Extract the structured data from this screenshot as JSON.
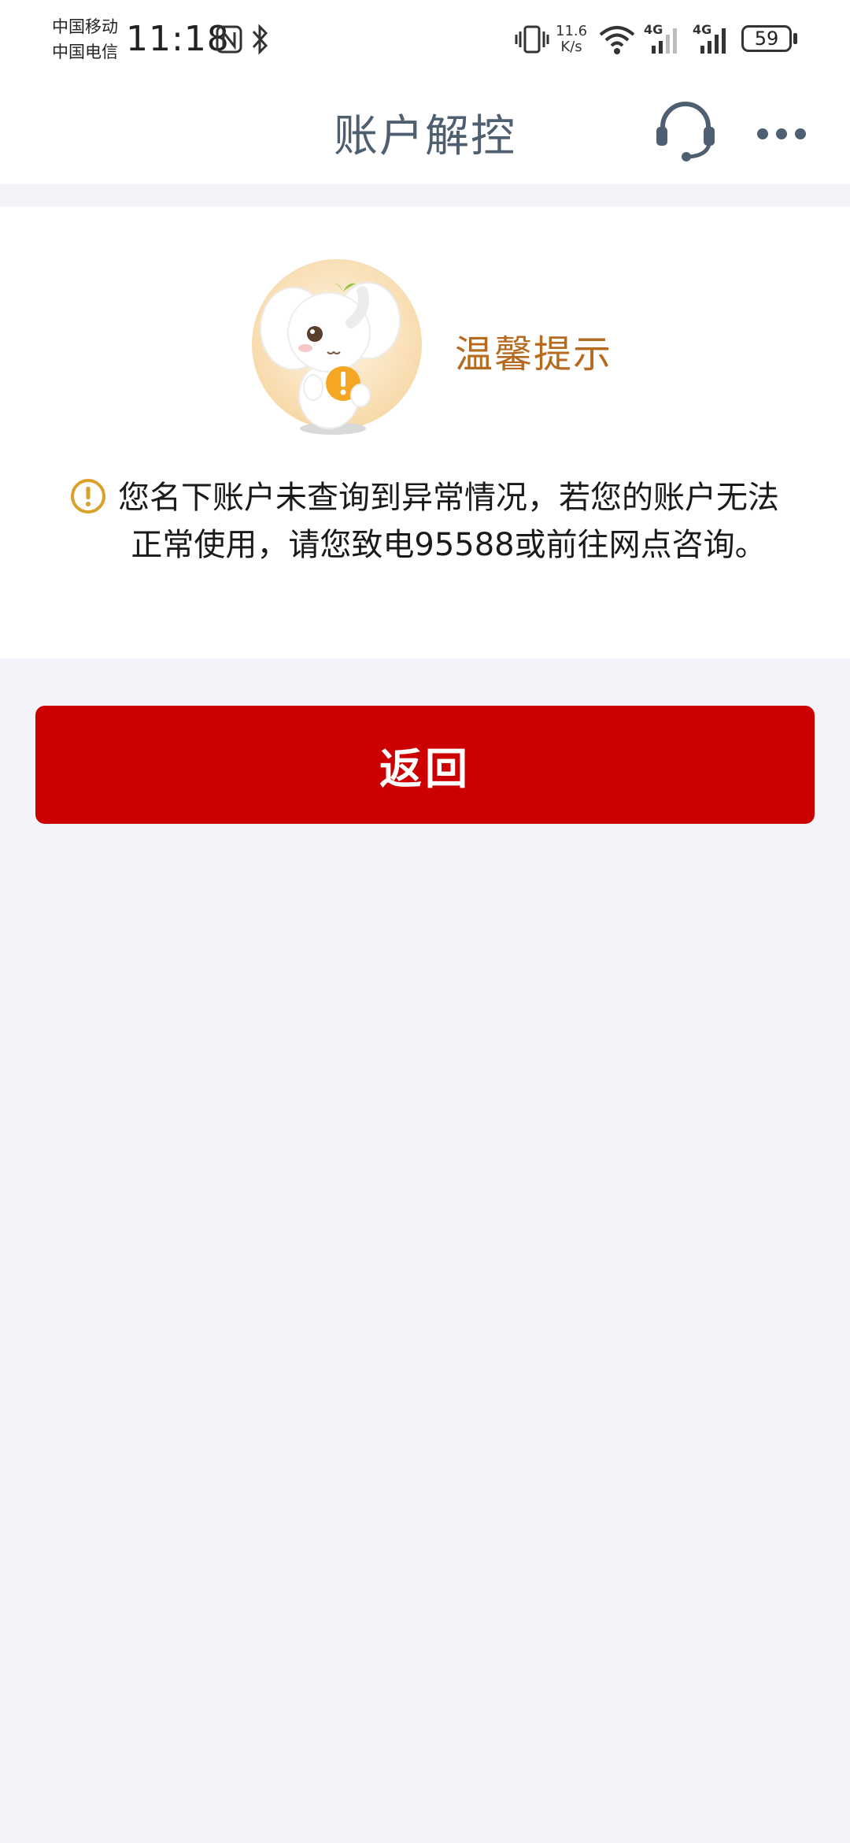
{
  "status_bar": {
    "carrier_1": "中国移动",
    "carrier_2": "中国电信",
    "time": "11:18",
    "net_speed_value": "11.6",
    "net_speed_unit": "K/s",
    "signal_1_label": "4G",
    "signal_2_label": "4G",
    "battery_level": "59",
    "icons": [
      "nfc-icon",
      "bluetooth-icon",
      "vibrate-icon",
      "wifi-icon",
      "signal-icon",
      "battery-icon"
    ]
  },
  "header": {
    "title": "账户解控",
    "icons": [
      "customer-service-icon",
      "more-icon"
    ]
  },
  "tip_card": {
    "title": "温馨提示",
    "message": "您名下账户未查询到异常情况，若您的账户无法正常使用，请您致电95588或前往网点咨询。",
    "icons": [
      "mascot-elephant",
      "warning-icon"
    ]
  },
  "actions": {
    "back_label": "返回"
  },
  "colors": {
    "accent_red": "#cc0000",
    "tip_title": "#b56a1f",
    "warning": "#d9a02a",
    "nav_title": "#4f5f72",
    "page_background": "#f3f3f9"
  }
}
